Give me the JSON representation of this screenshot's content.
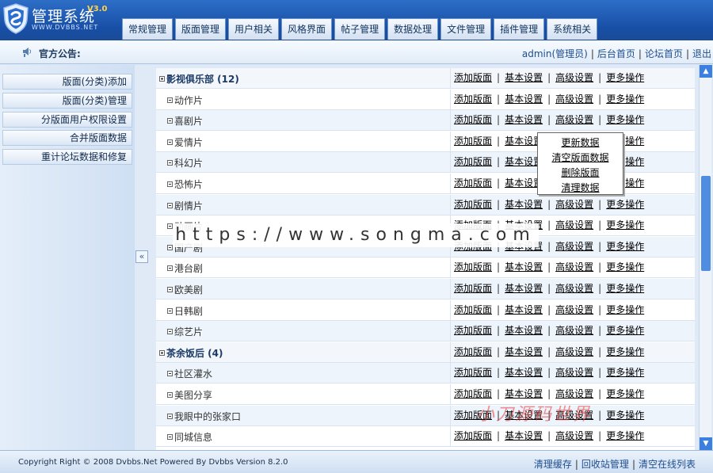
{
  "header": {
    "title": "管理系统",
    "version": "V3.0",
    "subtitle": "WWW.DVBBS.NET",
    "tabs": [
      "常规管理",
      "版面管理",
      "用户相关",
      "风格界面",
      "帖子管理",
      "数据处理",
      "文件管理",
      "插件管理",
      "系统相关"
    ]
  },
  "notice": {
    "label": "官方公告:",
    "links": [
      "admin(管理员)",
      "后台首页",
      "论坛首页",
      "退出"
    ]
  },
  "sidebar": {
    "items": [
      "版面(分类)添加",
      "版面(分类)管理",
      "分版面用户权限设置",
      "合并版面数据",
      "重计论坛数据和修复"
    ],
    "collapse_glyph": "«"
  },
  "actions": [
    "添加版面",
    "基本设置",
    "高级设置",
    "更多操作"
  ],
  "rows": [
    {
      "name": "影视俱乐部 (12)",
      "type": "group"
    },
    {
      "name": "动作片",
      "type": "child"
    },
    {
      "name": "喜剧片",
      "type": "child"
    },
    {
      "name": "爱情片",
      "type": "child"
    },
    {
      "name": "科幻片",
      "type": "child"
    },
    {
      "name": "恐怖片",
      "type": "child"
    },
    {
      "name": "剧情片",
      "type": "child"
    },
    {
      "name": "动画片",
      "type": "child"
    },
    {
      "name": "国产剧",
      "type": "child"
    },
    {
      "name": "港台剧",
      "type": "child"
    },
    {
      "name": "欧美剧",
      "type": "child"
    },
    {
      "name": "日韩剧",
      "type": "child"
    },
    {
      "name": "综艺片",
      "type": "child"
    },
    {
      "name": "茶余饭后 (4)",
      "type": "group"
    },
    {
      "name": "社区灌水",
      "type": "child"
    },
    {
      "name": "美图分享",
      "type": "child"
    },
    {
      "name": "我眼中的张家口",
      "type": "child"
    },
    {
      "name": "同城信息",
      "type": "child"
    }
  ],
  "dropdown": [
    "更新数据",
    "清空版面数据",
    "删除版面",
    "清理数据"
  ],
  "watermark": {
    "url": "https://www.songma.com",
    "overlay": "小刀源码世界"
  },
  "footer": {
    "copyright": "Copyright Right © 2008 Dvbbs.Net Powered By Dvbbs Version 8.2.0",
    "links": [
      "清理缓存",
      "回收站管理",
      "清空在线列表"
    ]
  },
  "colors": {
    "header_blue": "#1c56ac",
    "link_blue": "#1e4d8f",
    "accent_scroll": "#3b80e0"
  }
}
